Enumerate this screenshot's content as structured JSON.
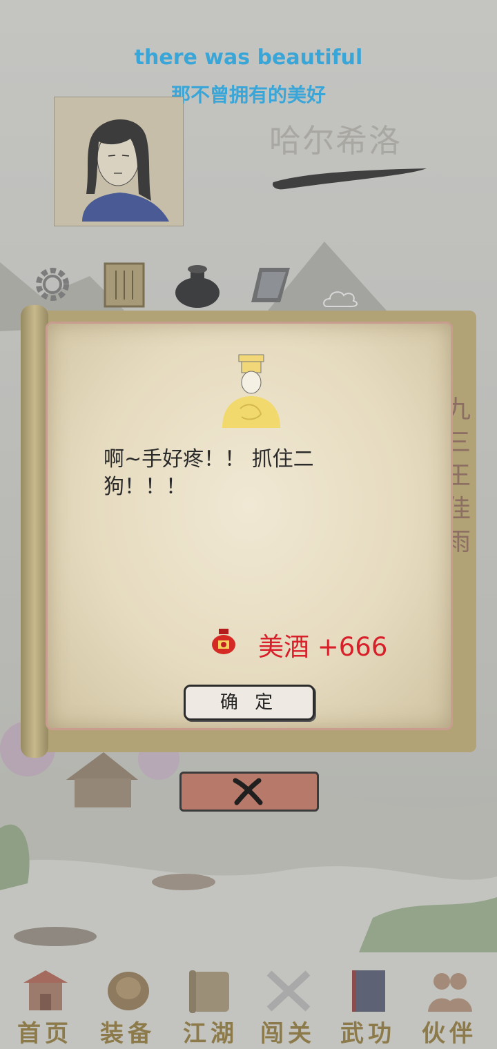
{
  "lyrics": {
    "english": "there was beautiful",
    "chinese": "那不曾拥有的美好"
  },
  "player": {
    "name": "哈尔希洛"
  },
  "dialog": {
    "message": "啊~手好疼！！ 抓住二狗！！！",
    "reward_item": "美酒",
    "reward_amount": "+666",
    "reward_text": "美酒 +666",
    "confirm_label": "确 定",
    "side_text": "九 三 王 佳 雨"
  },
  "nav": {
    "items": [
      {
        "label": "首页",
        "icon": "pavilion-icon"
      },
      {
        "label": "装备",
        "icon": "armor-icon"
      },
      {
        "label": "江湖",
        "icon": "scroll-icon"
      },
      {
        "label": "闯关",
        "icon": "crossed-swords-icon"
      },
      {
        "label": "武功",
        "icon": "book-icon"
      },
      {
        "label": "伙伴",
        "icon": "partners-icon"
      }
    ]
  },
  "colors": {
    "lyric": "#3aa6d8",
    "reward": "#d8202a",
    "paper": "#e6dbbf",
    "overlay": "#b9b9b5"
  }
}
